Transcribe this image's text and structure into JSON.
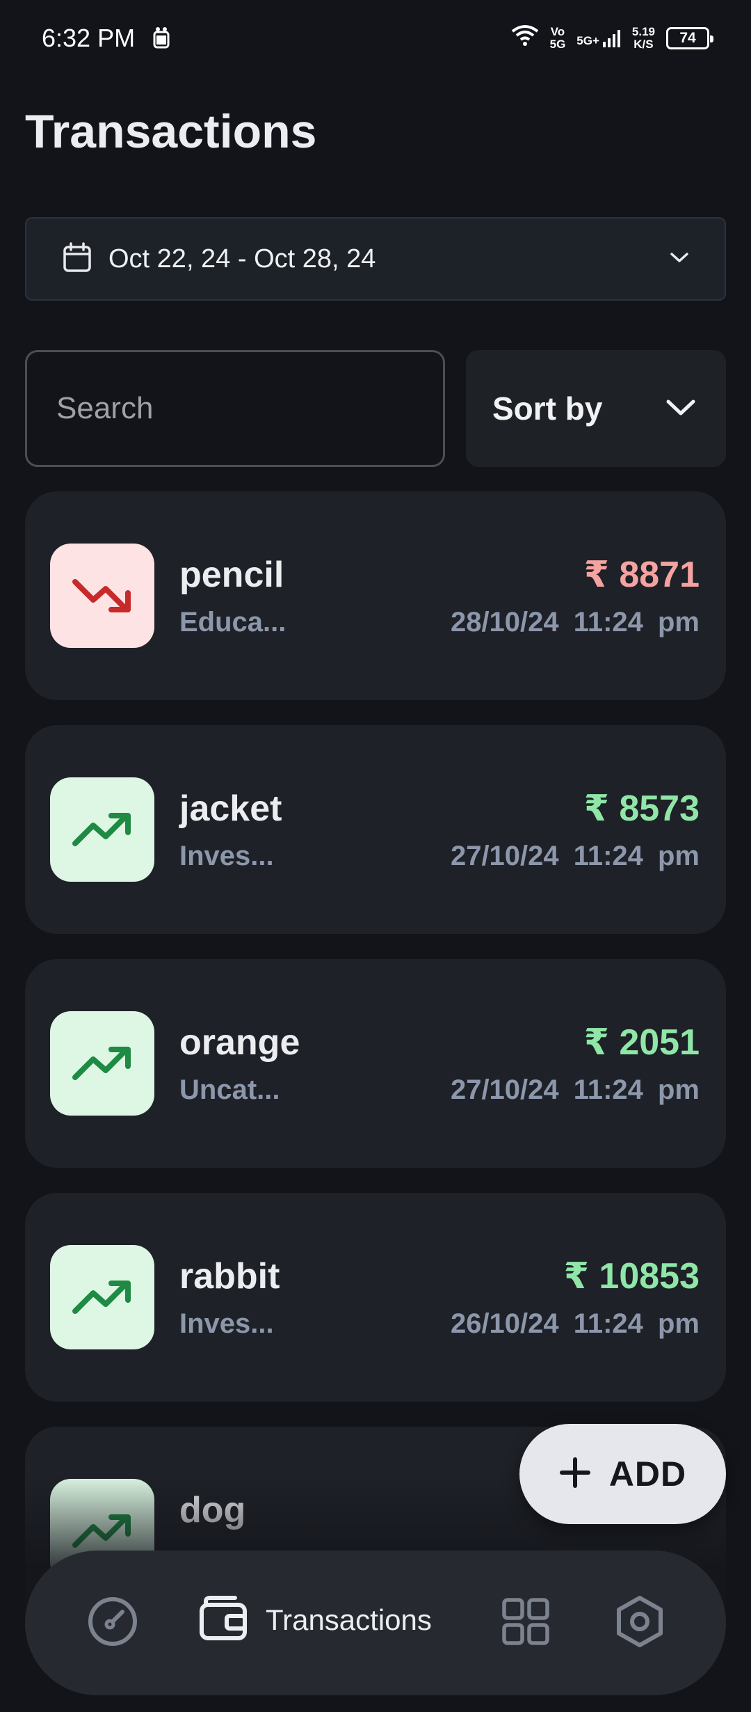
{
  "status_bar": {
    "time": "6:32 PM",
    "net_top": "Vo",
    "net_bottom": "5G",
    "signal_label": "5G+",
    "speed_value": "5.19",
    "speed_unit": "K/S",
    "battery": "74"
  },
  "header": {
    "title": "Transactions"
  },
  "date_filter": {
    "label": "Oct 22, 24 - Oct 28, 24",
    "icon": "calendar-icon"
  },
  "search": {
    "placeholder": "Search",
    "value": ""
  },
  "sort": {
    "label": "Sort by"
  },
  "colors": {
    "background": "#12141a",
    "card": "#1e2127",
    "expense_text": "#f5a3a1",
    "income_text": "#8fe6a7",
    "expense_tile": "#fde3e3",
    "income_tile": "#ddf7e4",
    "muted_text": "#8d97ab"
  },
  "transactions": [
    {
      "name": "pencil",
      "category": "Educa...",
      "amount": "₹ 8871",
      "date": "28/10/24",
      "time": "11:24 pm",
      "type": "expense",
      "icon": "trending-down-icon"
    },
    {
      "name": "jacket",
      "category": "Inves...",
      "amount": "₹ 8573",
      "date": "27/10/24",
      "time": "11:24 pm",
      "type": "income",
      "icon": "trending-up-icon"
    },
    {
      "name": "orange",
      "category": "Uncat...",
      "amount": "₹ 2051",
      "date": "27/10/24",
      "time": "11:24 pm",
      "type": "income",
      "icon": "trending-up-icon"
    },
    {
      "name": "rabbit",
      "category": "Inves...",
      "amount": "₹ 10853",
      "date": "26/10/24",
      "time": "11:24 pm",
      "type": "income",
      "icon": "trending-up-icon"
    },
    {
      "name": "dog",
      "category": "",
      "amount": "",
      "date": "",
      "time": "",
      "type": "income",
      "icon": "trending-up-icon"
    }
  ],
  "fab": {
    "label": "ADD",
    "icon": "plus-icon"
  },
  "bottom_nav": {
    "items": [
      {
        "id": "dashboard",
        "icon": "gauge-icon",
        "label": ""
      },
      {
        "id": "transactions",
        "icon": "wallet-icon",
        "label": "Transactions",
        "active": true
      },
      {
        "id": "categories",
        "icon": "grid-icon",
        "label": ""
      },
      {
        "id": "settings",
        "icon": "hexagon-settings-icon",
        "label": ""
      }
    ]
  }
}
